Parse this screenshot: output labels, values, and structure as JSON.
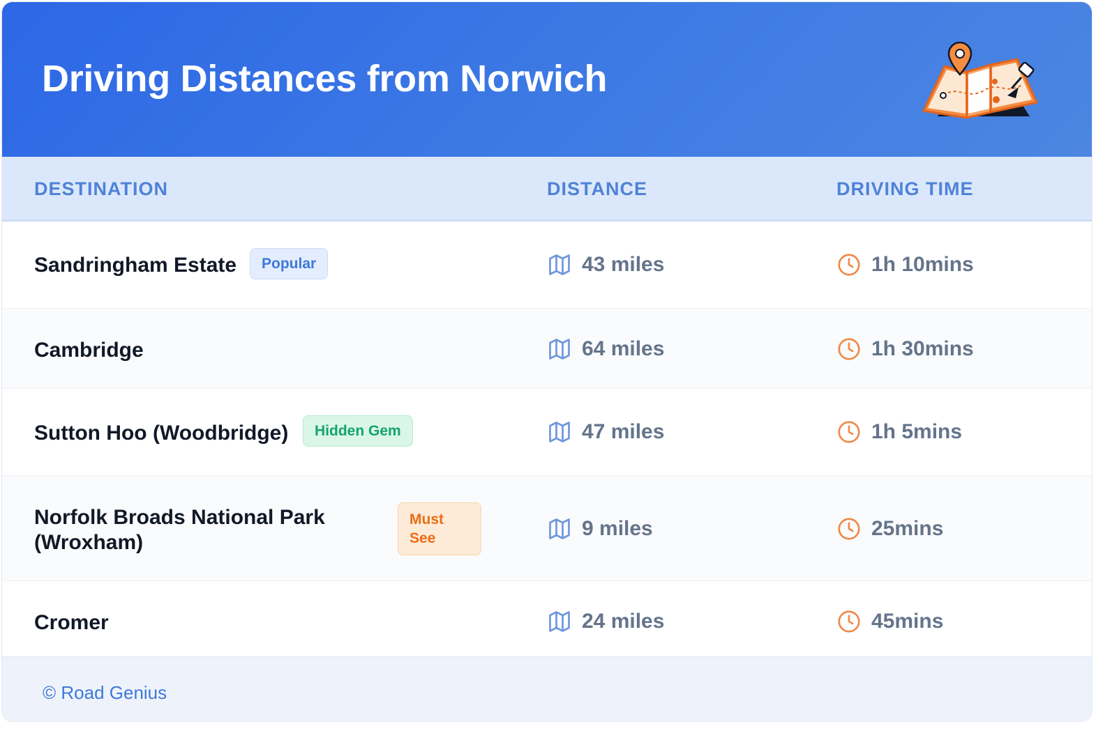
{
  "header": {
    "title": "Driving Distances from Norwich",
    "illustration": "folded-map-with-location-pin-icon"
  },
  "table": {
    "columns": [
      "DESTINATION",
      "DISTANCE",
      "DRIVING TIME"
    ],
    "rows": [
      {
        "destination": "Sandringham Estate",
        "badge": "Popular",
        "distance": "43 miles",
        "time": "1h 10mins"
      },
      {
        "destination": "Cambridge",
        "badge": "",
        "distance": "64 miles",
        "time": "1h 30mins"
      },
      {
        "destination": "Sutton Hoo (Woodbridge)",
        "badge": "Hidden Gem",
        "distance": "47 miles",
        "time": "1h 5mins"
      },
      {
        "destination": "Norfolk Broads National Park (Wroxham)",
        "badge": "Must See",
        "distance": "9 miles",
        "time": "25mins"
      },
      {
        "destination": "Cromer",
        "badge": "",
        "distance": "24 miles",
        "time": "45mins"
      }
    ]
  },
  "footer": {
    "credit": "© Road Genius"
  },
  "colors": {
    "header_gradient_start": "#2d67e6",
    "header_gradient_end": "#4c86e2",
    "table_header_bg": "#dbe8fb",
    "column_label": "#4f82d8",
    "badge_popular": "#3f78d9",
    "badge_hidden_gem": "#16a36a",
    "badge_must_see": "#ea6d16",
    "clock_icon": "#f08a4b",
    "map_icon": "#6f97dd"
  },
  "icons": {
    "distance": "map-icon",
    "time": "clock-icon"
  }
}
